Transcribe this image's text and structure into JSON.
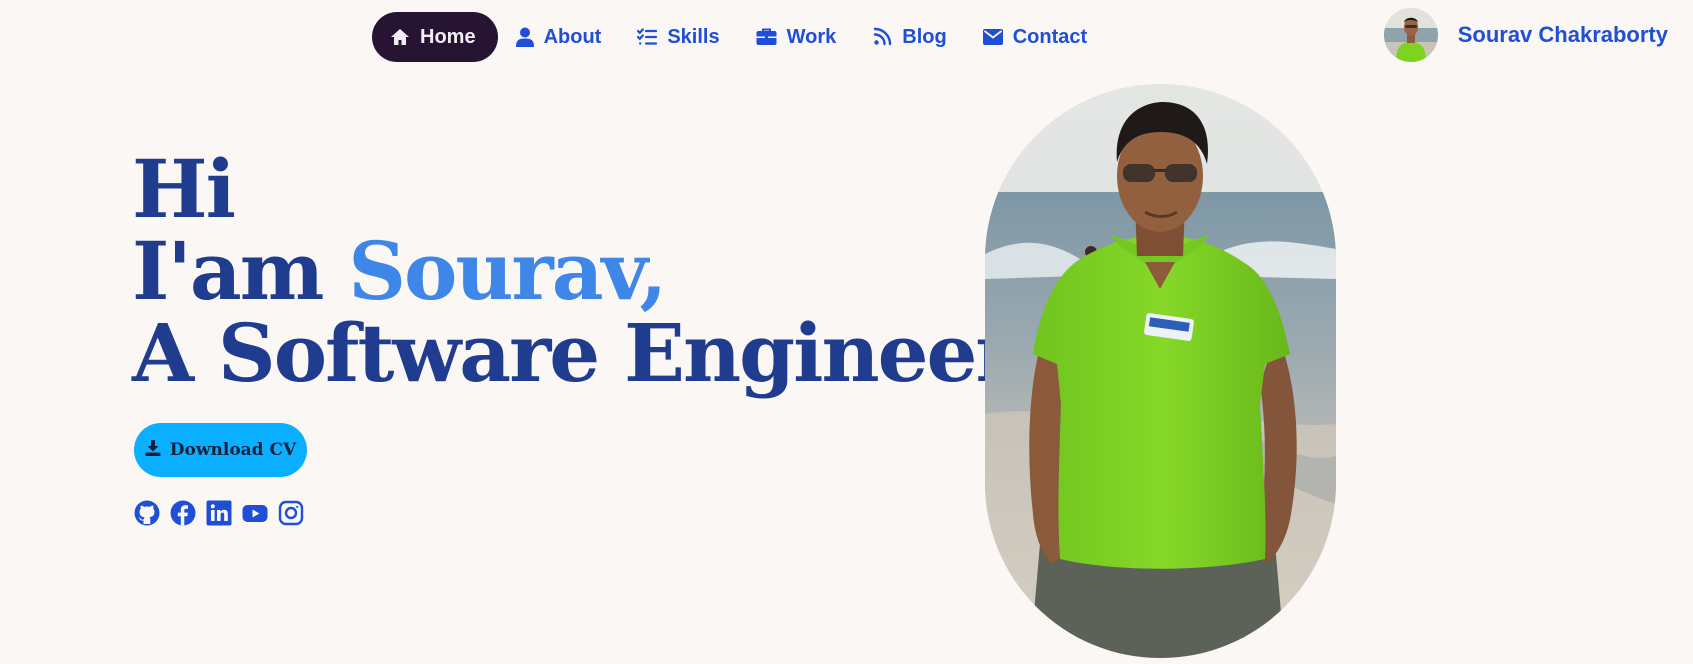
{
  "nav": {
    "items": [
      {
        "label": "Home",
        "icon": "home-icon",
        "active": true
      },
      {
        "label": "About",
        "icon": "user-icon",
        "active": false
      },
      {
        "label": "Skills",
        "icon": "checklist-icon",
        "active": false
      },
      {
        "label": "Work",
        "icon": "briefcase-icon",
        "active": false
      },
      {
        "label": "Blog",
        "icon": "rss-icon",
        "active": false
      },
      {
        "label": "Contact",
        "icon": "envelope-icon",
        "active": false
      }
    ]
  },
  "profile": {
    "name": "Sourav Chakraborty",
    "avatar": "profile-avatar"
  },
  "hero": {
    "line1": "Hi",
    "line2_prefix": "I'am ",
    "line2_name": "Sourav,",
    "line3": "A Software Engineer."
  },
  "cv_button": {
    "label": "Download CV",
    "icon": "download-icon"
  },
  "socials": [
    "github-icon",
    "facebook-icon",
    "linkedin-icon",
    "youtube-icon",
    "instagram-icon"
  ],
  "colors": {
    "background": "#fbf7f5",
    "nav_text": "#1f4fd6",
    "nav_active_bg": "#261432",
    "hero_text": "#1f3c8f",
    "hero_accent": "#3e86e8",
    "cv_button_bg": "#0ab0ff",
    "shirt_green": "#7ed321"
  }
}
